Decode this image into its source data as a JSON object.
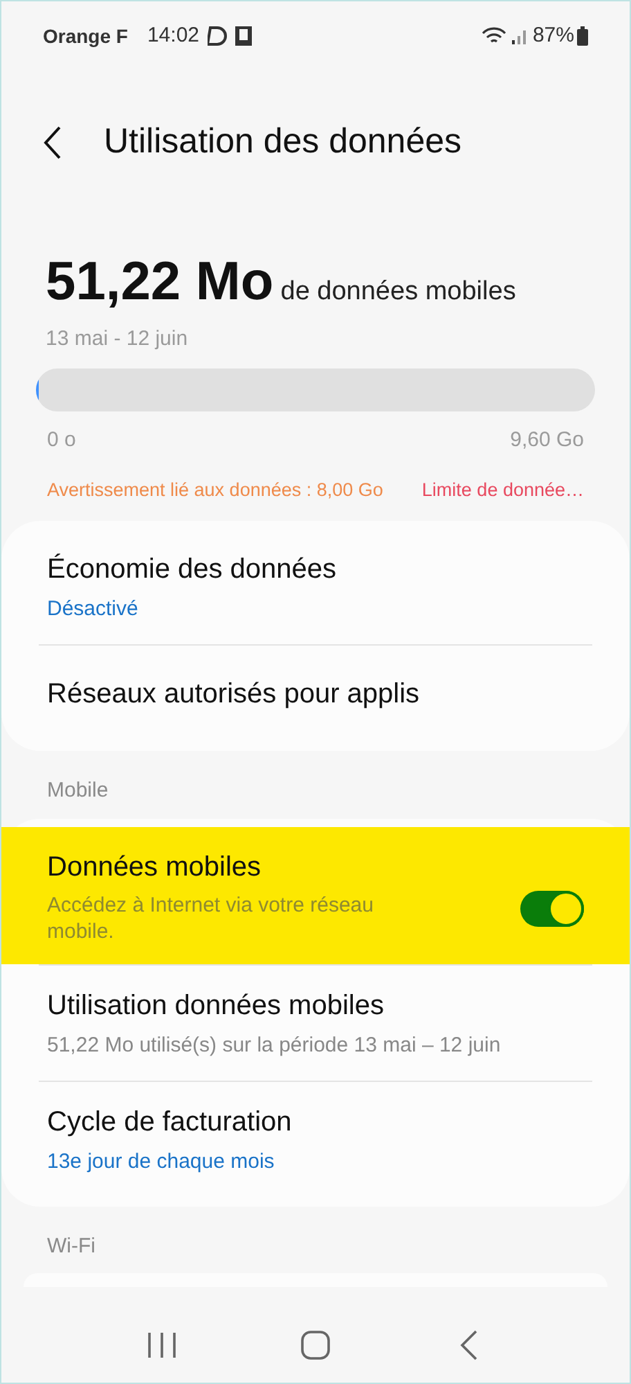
{
  "status_bar": {
    "carrier": "Orange F",
    "time": "14:02",
    "battery": "87%"
  },
  "header": {
    "title": "Utilisation des données"
  },
  "usage": {
    "amount": "51,22 Mo",
    "unit_label": "de données mobiles",
    "period": "13 mai - 12 juin",
    "level": 0.005,
    "min_label": "0 o",
    "max_label": "9,60 Go",
    "warning": "Avertissement lié aux données : 8,00 Go",
    "limit": "Limite de donnée…"
  },
  "sections": [
    {
      "items": [
        {
          "kind": "link",
          "title": "Économie des données",
          "subtitle": "Désactivé",
          "subtitle_accent": true
        },
        {
          "kind": "link",
          "title": "Réseaux autorisés pour applis"
        }
      ]
    },
    {
      "header": "Mobile",
      "items": [
        {
          "kind": "switch",
          "title": "Données mobiles",
          "subtitle": "Accédez à Internet via votre réseau mobile.",
          "on": true,
          "highlighted": true
        },
        {
          "kind": "link",
          "title": "Utilisation données mobiles",
          "subtitle": "51,22 Mo utilisé(s) sur la période 13 mai – 12 juin",
          "subtitle_accent": false
        },
        {
          "kind": "link",
          "title": "Cycle de facturation",
          "subtitle": "13e jour de chaque mois",
          "subtitle_accent": true
        }
      ]
    },
    {
      "header": "Wi-Fi"
    }
  ]
}
